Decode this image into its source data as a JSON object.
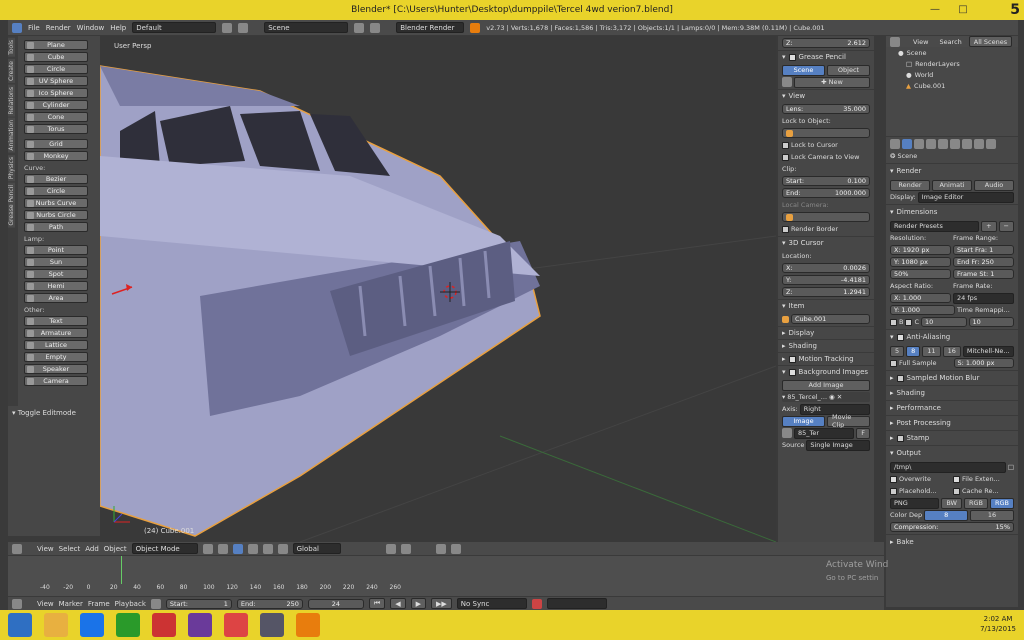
{
  "window": {
    "title": "Blender* [C:\\Users\\Hunter\\Desktop\\dumppile\\Tercel 4wd verion7.blend]",
    "badge": "5"
  },
  "infobar": {
    "menus": [
      "File",
      "Render",
      "Window",
      "Help"
    ],
    "layout": "Default",
    "scene": "Scene",
    "engine": "Blender Render",
    "stats": "v2.73 | Verts:1,678 | Faces:1,586 | Tris:3,172 | Objects:1/1 | Lamps:0/0 | Mem:9.38M (0.11M) | Cube.001"
  },
  "tabs": [
    "Tools",
    "Create",
    "Relations",
    "Animation",
    "Physics",
    "Grease Pencil"
  ],
  "toolshelf": {
    "mesh": [
      "Plane",
      "Cube",
      "Circle",
      "UV Sphere",
      "Ico Sphere",
      "Cylinder",
      "Cone",
      "Torus",
      "Grid",
      "Monkey"
    ],
    "curve_label": "Curve:",
    "curve": [
      "Bezier",
      "Circle",
      "Nurbs Curve",
      "Nurbs Circle",
      "Path"
    ],
    "lamp_label": "Lamp:",
    "lamp": [
      "Point",
      "Sun",
      "Spot",
      "Hemi",
      "Area"
    ],
    "other_label": "Other:",
    "other": [
      "Text",
      "Armature",
      "Lattice",
      "Empty",
      "Speaker",
      "Camera"
    ]
  },
  "lastop": {
    "title": "Toggle Editmode"
  },
  "viewport": {
    "view_name": "User Persp",
    "object_info": "(24) Cube.001"
  },
  "npanel": {
    "top_value_label": "Z:",
    "top_value": "2.612",
    "grease_pencil": "Grease Pencil",
    "gp_scene": "Scene",
    "gp_object": "Object",
    "gp_new": "New",
    "view_title": "View",
    "lens_label": "Lens:",
    "lens": "35.000",
    "lock_to_object": "Lock to Object:",
    "lock_to_cursor": "Lock to Cursor",
    "lock_camera": "Lock Camera to View",
    "clip_label": "Clip:",
    "clip_start_label": "Start:",
    "clip_start": "0.100",
    "clip_end_label": "End:",
    "clip_end": "1000.000",
    "local_camera": "Local Camera:",
    "render_border": "Render Border",
    "cursor_title": "3D Cursor",
    "location_label": "Location:",
    "cursor_x_label": "X:",
    "cursor_x": "0.0026",
    "cursor_y_label": "Y:",
    "cursor_y": "-4.4181",
    "cursor_z_label": "Z:",
    "cursor_z": "1.2941",
    "item_title": "Item",
    "item_name": "Cube.001",
    "display": "Display",
    "shading": "Shading",
    "motion_tracking": "Motion Tracking",
    "background_images": "Background Images",
    "add_image": "Add Image",
    "bg_image_name": "85_Tercel_...",
    "axis_label": "Axis:",
    "axis_value": "Right",
    "image_tab": "Image",
    "movie_clip_tab": "Movie Clip",
    "image_file": "85_Ter",
    "source_label": "Source",
    "source_value": "Single Image"
  },
  "outliner": {
    "view": "View",
    "search": "Search",
    "all_scenes": "All Scenes",
    "rows": [
      "Scene",
      "RenderLayers",
      "World",
      "Cube.001"
    ]
  },
  "props": {
    "scene": "Scene",
    "render_title": "Render",
    "render_btn": "Render",
    "anim_btn": "Animati",
    "audio_btn": "Audio",
    "display_label": "Display:",
    "display_value": "Image Editor",
    "dimensions": "Dimensions",
    "presets": "Render Presets",
    "resolution": "Resolution:",
    "frame_range": "Frame Range:",
    "res_x": "X: 1920 px",
    "res_y": "Y: 1080 px",
    "res_pct": "50%",
    "start_frame": "Start Fra: 1",
    "end_frame": "End Fr: 250",
    "frame_step": "Frame St: 1",
    "aspect_ratio": "Aspect Ratio:",
    "frame_rate": "Frame Rate:",
    "aspect_x": "X:  1.000",
    "aspect_y": "Y:  1.000",
    "fps": "24 fps",
    "time_remap": "Time Remappi...",
    "remap_old": "10",
    "remap_new": "10",
    "border_b": "B",
    "border_c": "C",
    "anti_aliasing": "Anti-Aliasing",
    "aa_samples": [
      "5",
      "8",
      "11",
      "16"
    ],
    "aa_filter": "Mitchell-Ne...",
    "full_sample": "Full Sample",
    "aa_size": "S: 1.000 px",
    "sampled_motion_blur": "Sampled Motion Blur",
    "shading": "Shading",
    "performance": "Performance",
    "post_processing": "Post Processing",
    "stamp": "Stamp",
    "output": "Output",
    "output_path": "/tmp\\",
    "overwrite": "Overwrite",
    "file_extensions": "File Exten...",
    "placeholders": "Placehold...",
    "cache_result": "Cache Re...",
    "format": "PNG",
    "bw": "BW",
    "rgb": "RGB",
    "rgba": "RGB",
    "color_depth": "Color Dep",
    "depth_8": "8",
    "depth_16": "16",
    "compression": "Compression:",
    "compression_value": "15%",
    "bake": "Bake"
  },
  "vpheader": {
    "menus": [
      "View",
      "Select",
      "Add",
      "Object"
    ],
    "mode": "Object Mode",
    "orientation": "Global"
  },
  "timeline": {
    "ticks": [
      "-40",
      "-20",
      "0",
      "20",
      "40",
      "60",
      "80",
      "100",
      "120",
      "140",
      "160",
      "180",
      "200",
      "220",
      "240",
      "260"
    ],
    "current_frame_marker": 24
  },
  "tlheader": {
    "menus": [
      "View",
      "Marker",
      "Frame",
      "Playback"
    ],
    "start_label": "Start:",
    "start": "1",
    "end_label": "End:",
    "end": "250",
    "current": "24",
    "sync": "No Sync"
  },
  "watermark": {
    "line1": "Activate Wind",
    "line2": "Go to PC settin"
  },
  "taskbar": {
    "time": "2:02 AM",
    "date": "7/13/2015"
  },
  "colors": {
    "accent": "#5680c2",
    "chrome": "#e9d32a",
    "selected_outline": "#e8a040"
  }
}
